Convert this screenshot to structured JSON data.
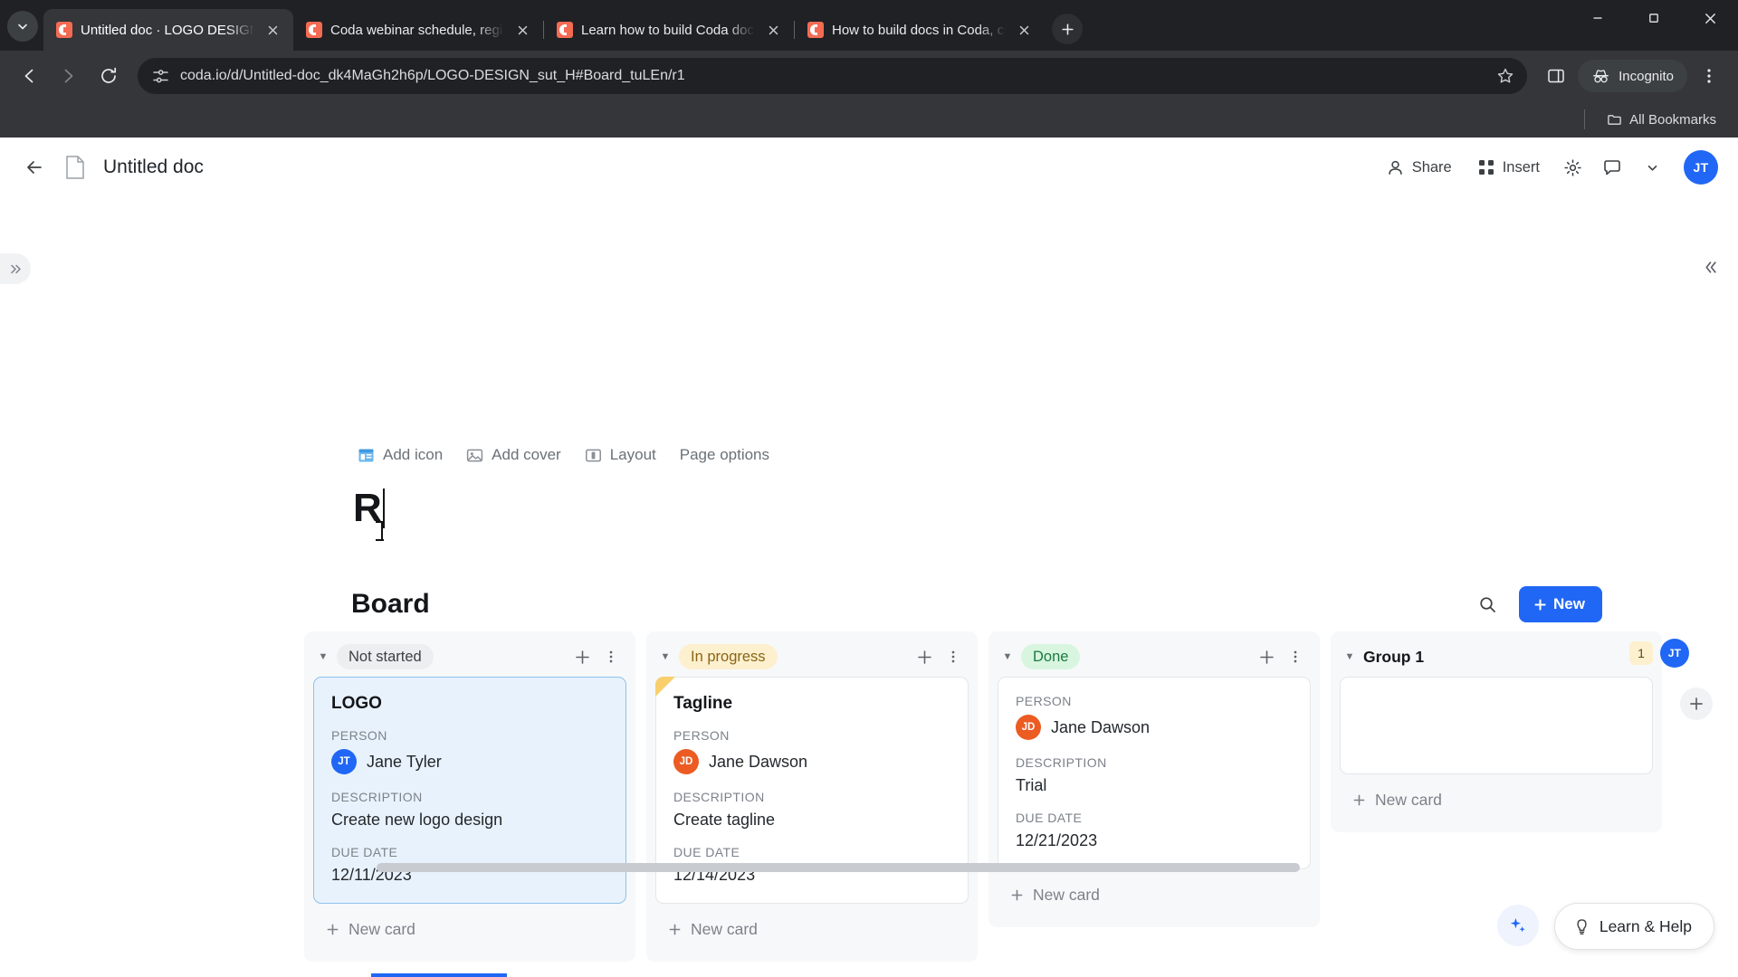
{
  "browser": {
    "tabs": [
      {
        "title": "Untitled doc · LOGO DESIGN",
        "favicon": "coda-favicon",
        "active": true
      },
      {
        "title": "Coda webinar schedule, registr",
        "favicon": "coda-favicon",
        "active": false
      },
      {
        "title": "Learn how to build Coda docs",
        "favicon": "coda-favicon",
        "active": false
      },
      {
        "title": "How to build docs in Coda, cre",
        "favicon": "coda-favicon",
        "active": false
      }
    ],
    "new_tab_label": "+",
    "tab_search_icon": "chevron-down-icon",
    "nav": {
      "back_icon": "back-arrow-icon",
      "forward_icon": "forward-arrow-icon",
      "reload_icon": "reload-icon"
    },
    "omnibox": {
      "site_icon": "site-settings-icon",
      "url": "coda.io/d/Untitled-doc_dk4MaGh2h6p/LOGO-DESIGN_sut_H#Board_tuLEn/r1",
      "bookmark_icon": "star-icon",
      "sidepanel_icon": "side-panel-icon",
      "menu_icon": "kebab-menu-icon"
    },
    "incognito_label": "Incognito",
    "bookmarks": {
      "all_bookmarks_label": "All Bookmarks",
      "folder_icon": "folder-icon"
    },
    "window_controls": {
      "minimize": "−",
      "maximize": "▢",
      "close": "✕"
    }
  },
  "doc": {
    "back_icon": "back-arrow-icon",
    "doc_icon": "document-icon",
    "title": "Untitled doc",
    "header_actions": {
      "share_label": "Share",
      "share_icon": "person-icon",
      "insert_label": "Insert",
      "insert_icon": "grid-icon",
      "settings_icon": "gear-icon",
      "comment_icon": "comment-icon",
      "chevron_icon": "chevron-down-icon"
    },
    "avatar": {
      "initials": "JT",
      "color": "#2167f5"
    },
    "left_collapse_icon": "expand-right-icon",
    "right_collapse_icon": "collapse-right-icon"
  },
  "page_toolbar": [
    {
      "label": "Add icon",
      "icon": "add-icon-icon"
    },
    {
      "label": "Add cover",
      "icon": "image-icon"
    },
    {
      "label": "Layout",
      "icon": "layout-icon"
    },
    {
      "label": "Page options",
      "icon": ""
    }
  ],
  "page": {
    "title": "R"
  },
  "board": {
    "title": "Board",
    "search_icon": "search-icon",
    "new_button_label": "New",
    "new_button_icon": "plus-icon",
    "new_button_color": "#2167f5",
    "add_column_icon": "plus-icon",
    "columns": [
      {
        "name": "Not started",
        "chip_bg": "#eceef0",
        "chip_color": "#3c4043",
        "type": "chip",
        "caret_icon": "caret-down-icon",
        "add_icon": "plus-icon",
        "menu_icon": "kebab-menu-icon",
        "new_card_label": "New card",
        "cards": [
          {
            "title": "LOGO",
            "selected": true,
            "flagged": false,
            "person_label": "PERSON",
            "person_name": "Jane Tyler",
            "person_initials": "JT",
            "person_color": "#2167f5",
            "description_label": "DESCRIPTION",
            "description": "Create new logo design",
            "due_label": "DUE DATE",
            "due_date": "12/11/2023"
          }
        ]
      },
      {
        "name": "In progress",
        "chip_bg": "#fdf0cf",
        "chip_color": "#8a6512",
        "type": "chip",
        "caret_icon": "caret-down-icon",
        "add_icon": "plus-icon",
        "menu_icon": "kebab-menu-icon",
        "new_card_label": "New card",
        "cards": [
          {
            "title": "Tagline",
            "selected": false,
            "flagged": true,
            "person_label": "PERSON",
            "person_name": "Jane Dawson",
            "person_initials": "JD",
            "person_color": "#ec5b22",
            "description_label": "DESCRIPTION",
            "description": "Create tagline",
            "due_label": "DUE DATE",
            "due_date": "12/14/2023"
          }
        ]
      },
      {
        "name": "Done",
        "chip_bg": "#d8f5e0",
        "chip_color": "#1b7a3f",
        "type": "chip",
        "caret_icon": "caret-down-icon",
        "add_icon": "plus-icon",
        "menu_icon": "kebab-menu-icon",
        "new_card_label": "New card",
        "cards": [
          {
            "title": "",
            "selected": false,
            "flagged": false,
            "person_label": "PERSON",
            "person_name": "Jane Dawson",
            "person_initials": "JD",
            "person_color": "#ec5b22",
            "description_label": "DESCRIPTION",
            "description": "Trial",
            "due_label": "DUE DATE",
            "due_date": "12/21/2023"
          }
        ]
      },
      {
        "name": "Group 1",
        "chip_bg": "",
        "chip_color": "#14161a",
        "type": "plain",
        "caret_icon": "caret-down-icon",
        "add_icon": "plus-icon",
        "menu_icon": "",
        "new_card_label": "New card",
        "count_badge": "1",
        "collaborator": {
          "initials": "JT",
          "color": "#2167f5"
        },
        "cards": [
          {
            "empty": true
          }
        ]
      }
    ]
  },
  "footer": {
    "ai_icon": "sparkle-icon",
    "help_label": "Learn & Help",
    "help_icon": "lightbulb-icon"
  }
}
